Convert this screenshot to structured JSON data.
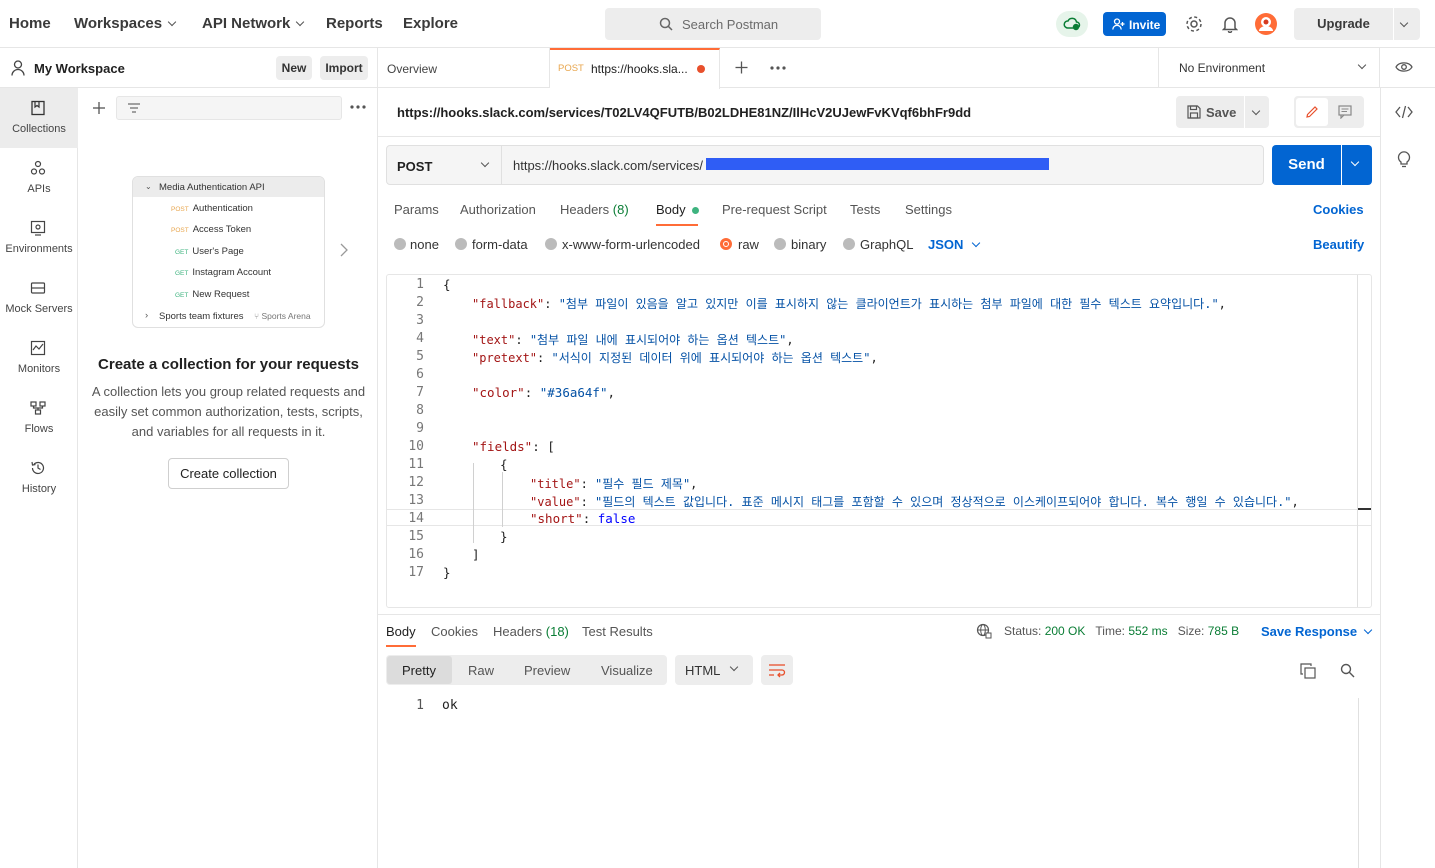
{
  "topnav": {
    "home": "Home",
    "workspaces": "Workspaces",
    "api_network": "API Network",
    "reports": "Reports",
    "explore": "Explore",
    "search_placeholder": "Search Postman",
    "invite": "Invite",
    "upgrade": "Upgrade"
  },
  "workspace": {
    "title": "My Workspace",
    "new_label": "New",
    "import_label": "Import"
  },
  "leftnav": [
    {
      "label": "Collections",
      "icon": "collections-icon",
      "active": true
    },
    {
      "label": "APIs",
      "icon": "apis-icon"
    },
    {
      "label": "Environments",
      "icon": "environments-icon"
    },
    {
      "label": "Mock Servers",
      "icon": "mock-servers-icon"
    },
    {
      "label": "Monitors",
      "icon": "monitors-icon"
    },
    {
      "label": "Flows",
      "icon": "flows-icon"
    },
    {
      "label": "History",
      "icon": "history-icon"
    }
  ],
  "illustration": {
    "collection_name": "Media Authentication API",
    "requests": [
      {
        "method": "POST",
        "name": "Authentication"
      },
      {
        "method": "POST",
        "name": "Access Token"
      },
      {
        "method": "GET",
        "name": "User's Page"
      },
      {
        "method": "GET",
        "name": "Instagram Account"
      },
      {
        "method": "GET",
        "name": "New Request"
      }
    ],
    "folder_name": "Sports team fixtures",
    "folder_fork": "Sports Arena"
  },
  "empty_state": {
    "title": "Create a collection for your requests",
    "description": "A collection lets you group related requests and easily set common authorization, tests, scripts, and variables for all requests in it.",
    "button": "Create collection"
  },
  "tabs": {
    "overview": "Overview",
    "active_method": "POST",
    "active_title": "https://hooks.sla...",
    "environment": "No Environment"
  },
  "request": {
    "title": "https://hooks.slack.com/services/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",
    "save": "Save",
    "method": "POST",
    "url": "https://hooks.slack.com/services/",
    "send": "Send",
    "tabs": {
      "params": "Params",
      "authorization": "Authorization",
      "headers": "Headers",
      "headers_count": "(8)",
      "body": "Body",
      "prerequest": "Pre-request Script",
      "tests": "Tests",
      "settings": "Settings"
    },
    "cookies": "Cookies",
    "body_modes": {
      "none": "none",
      "form_data": "form-data",
      "urlencoded": "x-www-form-urlencoded",
      "raw": "raw",
      "binary": "binary",
      "graphql": "GraphQL",
      "language": "JSON"
    },
    "beautify": "Beautify"
  },
  "code": {
    "line_numbers": [
      "1",
      "2",
      "3",
      "4",
      "5",
      "6",
      "7",
      "8",
      "9",
      "10",
      "11",
      "12",
      "13",
      "14",
      "15",
      "16",
      "17"
    ],
    "open_brace": "{",
    "close_brace": "}",
    "fallback_key": "\"fallback\"",
    "fallback_val": "\"첨부 파일이 있음을 알고 있지만 이를 표시하지 않는 클라이언트가 표시하는 첨부 파일에 대한 필수 텍스트 요약입니다.\"",
    "text_key": "\"text\"",
    "text_val": "\"첨부 파일 내에 표시되어야 하는 옵션 텍스트\"",
    "pretext_key": "\"pretext\"",
    "pretext_val": "\"서식이 지정된 데이터 위에 표시되어야 하는 옵션 텍스트\"",
    "color_key": "\"color\"",
    "color_val": "\"#36a64f\"",
    "fields_key": "\"fields\"",
    "open_bracket": "[",
    "close_bracket": "]",
    "title_key": "\"title\"",
    "title_val": "\"필수 필드 제목\"",
    "value_key": "\"value\"",
    "value_val": "\"필드의 텍스트 값입니다. 표준 메시지 태그를 포함할 수 있으며 정상적으로 이스케이프되어야 합니다. 복수 행일 수 있습니다.\"",
    "short_key": "\"short\"",
    "short_val": "false",
    "colon": ": ",
    "comma": ","
  },
  "response": {
    "tabs": {
      "body": "Body",
      "cookies": "Cookies",
      "headers": "Headers",
      "headers_count": "(18)",
      "test_results": "Test Results"
    },
    "status_label": "Status:",
    "status_value": "200 OK",
    "time_label": "Time:",
    "time_value": "552 ms",
    "size_label": "Size:",
    "size_value": "785 B",
    "save_response": "Save Response",
    "views": {
      "pretty": "Pretty",
      "raw": "Raw",
      "preview": "Preview",
      "visualize": "Visualize"
    },
    "format": "HTML",
    "line_number": "1",
    "body": "ok"
  },
  "colors": {
    "accent": "#ff6c37",
    "primary": "#0265d2",
    "success": "#0a7d35"
  }
}
